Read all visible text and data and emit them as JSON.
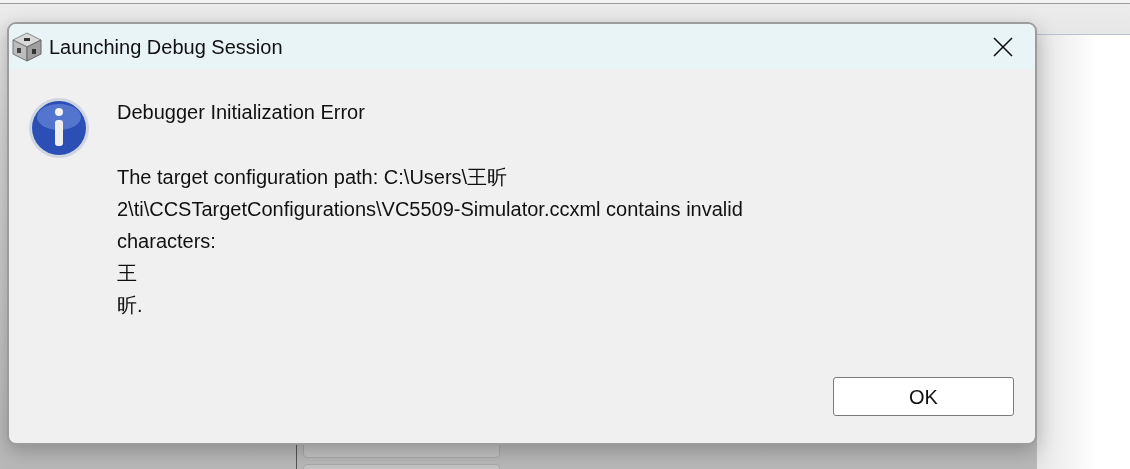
{
  "dialog": {
    "title": "Launching Debug Session",
    "heading": "Debugger Initialization Error",
    "message_lines": [
      "The target configuration path: C:\\Users\\王昕",
      "2\\ti\\CCSTargetConfigurations\\VC5509-Simulator.ccxml contains invalid",
      "characters:",
      "王",
      "昕."
    ],
    "buttons": [
      "OK"
    ]
  }
}
